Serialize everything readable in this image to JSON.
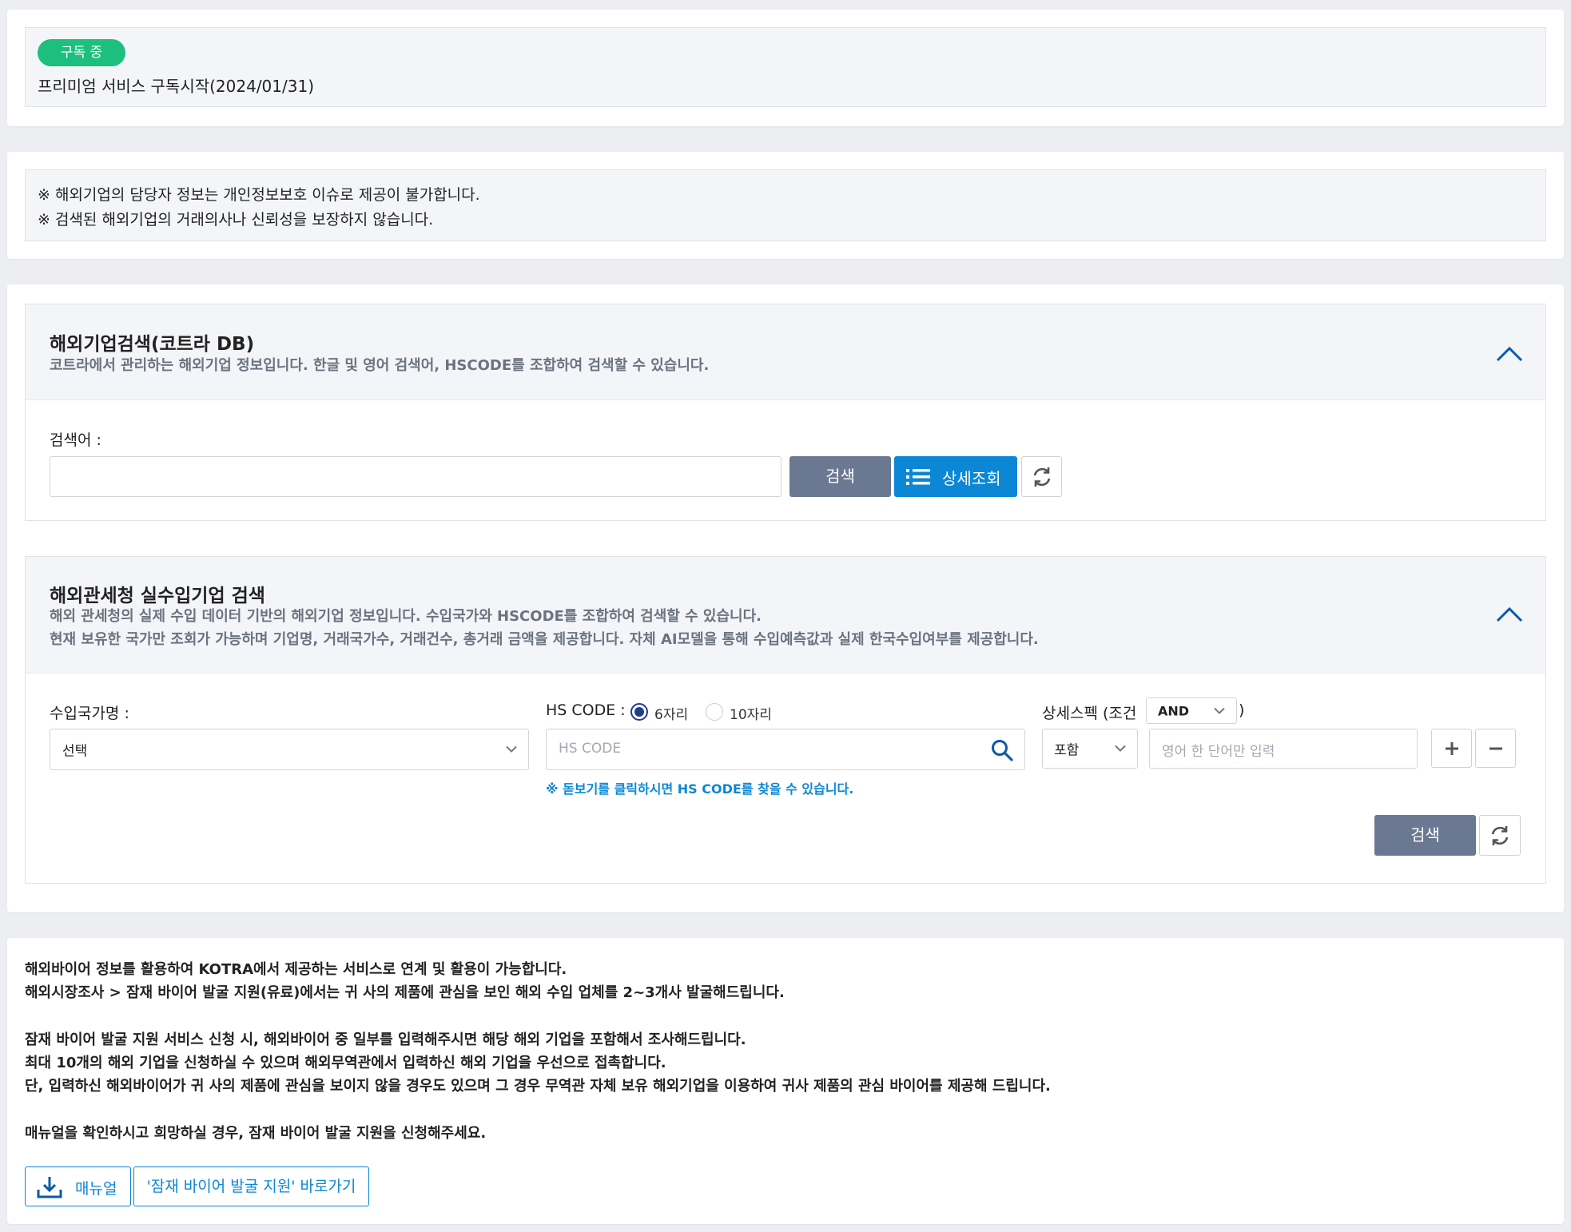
{
  "subscription": {
    "badge": "구독 중",
    "status_text": "프리미엄 서비스 구독시작(2024/01/31)"
  },
  "notices": [
    "※ 해외기업의 담당자 정보는 개인정보보호 이슈로 제공이 불가합니다.",
    "※ 검색된 해외기업의 거래의사나 신뢰성을 보장하지 않습니다."
  ],
  "kotra_search": {
    "title": "해외기업검색(코트라 DB)",
    "description": "코트라에서 관리하는 해외기업 정보입니다. 한글 및 영어 검색어, HSCODE를 조합하여 검색할 수 있습니다.",
    "keyword_label": "검색어 :",
    "keyword_value": "",
    "search_button": "검색",
    "detail_button": "상세조회"
  },
  "customs_search": {
    "title": "해외관세청 실수입기업 검색",
    "description_1": "해외 관세청의 실제 수입 데이터 기반의 해외기업 정보입니다. 수입국가와 HSCODE를 조합하여 검색할 수 있습니다.",
    "description_2": "현재 보유한 국가만 조회가 가능하며 기업명, 거래국가수, 거래건수, 총거래 금액을 제공합니다. 자체 AI모델을 통해 수입예측값과 실제 한국수입여부를 제공합니다.",
    "country_label": "수입국가명 :",
    "country_value": "선택",
    "hscode_label": "HS CODE :",
    "hscode_options": [
      "6자리",
      "10자리"
    ],
    "hscode_selected": "6자리",
    "hscode_placeholder": "HS CODE",
    "hscode_hint": "※ 돋보기를 클릭하시면 HS CODE를 찾을 수 있습니다.",
    "spec_label_prefix": "상세스펙 (조건",
    "spec_label_suffix": ")",
    "spec_condition": "AND",
    "spec_match": "포함",
    "spec_placeholder": "영어 한 단어만 입력",
    "search_button": "검색"
  },
  "info": {
    "lines": [
      "해외바이어 정보를 활용하여 KOTRA에서 제공하는 서비스로 연계 및 활용이 가능합니다.",
      "해외시장조사 > 잠재 바이어 발굴 지원(유료)에서는 귀 사의 제품에 관심을 보인 해외 수입 업체를 2~3개사 발굴해드립니다.",
      "잠재 바이어 발굴 지원 서비스 신청 시, 해외바이어 중 일부를 입력해주시면 해당 해외 기업을 포함해서 조사해드립니다.",
      "최대 10개의 해외 기업을 신청하실 수 있으며 해외무역관에서 입력하신 해외 기업을 우선으로 접촉합니다.",
      "단, 입력하신 해외바이어가 귀 사의 제품에 관심을 보이지 않을 경우도 있으며 그 경우 무역관 자체 보유 해외기업을 이용하여 귀사 제품의 관심 바이어를 제공해 드립니다.",
      "매뉴얼을 확인하시고 희망하실 경우, 잠재 바이어 발굴 지원을 신청해주세요."
    ],
    "manual_button": "매뉴얼",
    "shortcut_button": "'잠재 바이어 발굴 지원' 바로가기"
  },
  "colors": {
    "badge_green": "#1cbf7d",
    "primary_blue": "#0b87d6",
    "button_slate": "#6b7891",
    "background": "#eceef2"
  },
  "icons": [
    "chevron-up-icon",
    "list-icon",
    "refresh-icon",
    "chevron-down-icon",
    "search-icon",
    "plus-icon",
    "minus-icon",
    "download-icon"
  ]
}
